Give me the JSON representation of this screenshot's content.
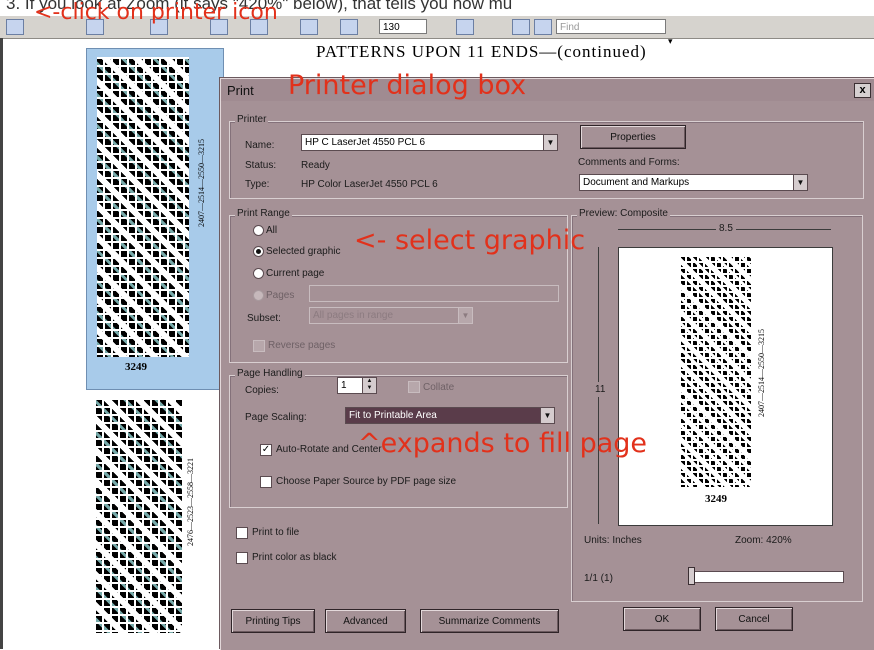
{
  "top_clipped_text": "3.   If you look at Zoom (it says \"420%\" below), that tells you how mu",
  "toolbar": {
    "zoom_value": "130",
    "find_placeholder": "Find"
  },
  "document": {
    "title": "PATTERNS UPON 11 ENDS—(continued)",
    "pattern1_caption": "3249",
    "pattern1_sideline": "2407—2514—2550—3215",
    "pattern2_sideline": "2476—2523—2558—3221"
  },
  "dialog": {
    "title": "Print",
    "close_label": "x",
    "printer": {
      "group_label": "Printer",
      "name_label": "Name:",
      "name_value": "HP C LaserJet 4550 PCL 6",
      "status_label": "Status:",
      "status_value": "Ready",
      "type_label": "Type:",
      "type_value": "HP Color LaserJet 4550 PCL 6",
      "properties_button": "Properties",
      "comments_label": "Comments and Forms:",
      "comments_value": "Document and Markups"
    },
    "print_range": {
      "group_label": "Print Range",
      "all": "All",
      "selected_graphic": "Selected graphic",
      "current_page": "Current page",
      "pages": "Pages",
      "subset_label": "Subset:",
      "subset_value": "All pages in range",
      "reverse_pages": "Reverse pages"
    },
    "page_handling": {
      "group_label": "Page Handling",
      "copies_label": "Copies:",
      "copies_value": "1",
      "collate": "Collate",
      "scaling_label": "Page Scaling:",
      "scaling_value": "Fit to Printable Area",
      "auto_rotate": "Auto-Rotate and Center",
      "paper_source": "Choose Paper Source by PDF page size"
    },
    "print_to_file": "Print to file",
    "print_color_black": "Print color as black",
    "preview": {
      "group_label": "Preview: Composite",
      "width": "8.5",
      "height": "11",
      "caption": "3249",
      "sideline": "2407—2514—2550—3215",
      "units": "Units: Inches",
      "zoom": "Zoom: 420%",
      "page_count": "1/1 (1)"
    },
    "buttons": {
      "printing_tips": "Printing Tips",
      "advanced": "Advanced",
      "summarize": "Summarize Comments",
      "ok": "OK",
      "cancel": "Cancel"
    }
  },
  "annotations": {
    "printer_icon": "<-click on printer icon",
    "dialog_box": "Printer dialog box",
    "select_graphic": "<- select graphic",
    "expands": "^expands to fill page"
  },
  "colors": {
    "annotation": "#e2311b",
    "dialog_bg": "#a59196",
    "selection": "#a8cbea"
  }
}
